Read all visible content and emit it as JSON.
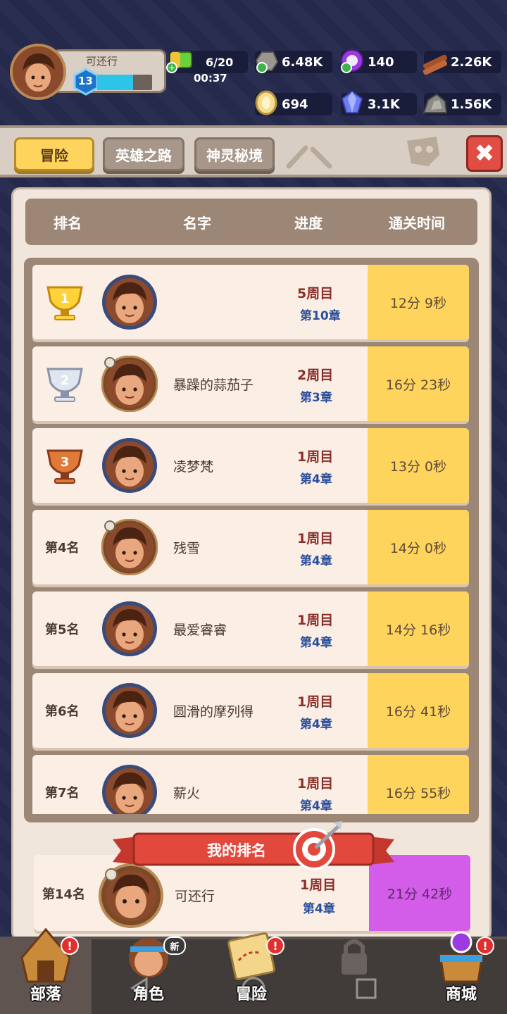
{
  "player": {
    "name": "可还行",
    "level": "13",
    "xp_fraction": 0.65
  },
  "resources": {
    "energy": {
      "value": "6/20",
      "timer": "00:37",
      "icon": "energy-battery-icon"
    },
    "stone": {
      "value": "6.48K",
      "icon": "stone-icon"
    },
    "orb": {
      "value": "140",
      "icon": "purple-orb-icon"
    },
    "wood": {
      "value": "2.26K",
      "icon": "wood-logs-icon"
    },
    "bone": {
      "value": "694",
      "icon": "bone-coin-icon"
    },
    "gem": {
      "value": "3.1K",
      "icon": "blue-gem-icon"
    },
    "ore": {
      "value": "1.56K",
      "icon": "ore-icon"
    }
  },
  "tabs": [
    {
      "label": "冒险",
      "active": true
    },
    {
      "label": "英雄之路",
      "active": false
    },
    {
      "label": "神灵秘境",
      "active": false
    }
  ],
  "close_label": "✖",
  "table": {
    "headers": {
      "rank": "排名",
      "name": "名字",
      "progress": "进度",
      "time": "通关时间"
    },
    "rows": [
      {
        "rank": "",
        "trophy": "gold",
        "trophy_num": "1",
        "name": "",
        "cycle": "5周目",
        "chapter": "第10章",
        "time": "12分 9秒",
        "framed_avatar": false
      },
      {
        "rank": "",
        "trophy": "silver",
        "trophy_num": "2",
        "name": "暴躁的蒜茄子",
        "cycle": "2周目",
        "chapter": "第3章",
        "time": "16分 23秒",
        "framed_avatar": true
      },
      {
        "rank": "",
        "trophy": "bronze",
        "trophy_num": "3",
        "name": "凌梦梵",
        "cycle": "1周目",
        "chapter": "第4章",
        "time": "13分 0秒",
        "framed_avatar": false
      },
      {
        "rank": "第4名",
        "trophy": "",
        "trophy_num": "",
        "name": "残雪",
        "cycle": "1周目",
        "chapter": "第4章",
        "time": "14分 0秒",
        "framed_avatar": true
      },
      {
        "rank": "第5名",
        "trophy": "",
        "trophy_num": "",
        "name": "最爱睿睿",
        "cycle": "1周目",
        "chapter": "第4章",
        "time": "14分 16秒",
        "framed_avatar": false
      },
      {
        "rank": "第6名",
        "trophy": "",
        "trophy_num": "",
        "name": "圆滑的摩列得",
        "cycle": "1周目",
        "chapter": "第4章",
        "time": "16分 41秒",
        "framed_avatar": false
      },
      {
        "rank": "第7名",
        "trophy": "",
        "trophy_num": "",
        "name": "薪火",
        "cycle": "1周目",
        "chapter": "第4章",
        "time": "16分 55秒",
        "framed_avatar": false
      }
    ]
  },
  "my_rank": {
    "title": "我的排名",
    "rank": "第14名",
    "name": "可还行",
    "cycle": "1周目",
    "chapter": "第4章",
    "time": "21分 42秒"
  },
  "nav": [
    {
      "label": "部落",
      "icon": "tribe-hut-icon",
      "badge": "!",
      "active": true
    },
    {
      "label": "角色",
      "icon": "character-icon",
      "badge": "新",
      "active": false
    },
    {
      "label": "冒险",
      "icon": "adventure-map-icon",
      "badge": "!",
      "active": false
    },
    {
      "label": "",
      "icon": "lock-icon",
      "badge": "",
      "active": false
    },
    {
      "label": "商城",
      "icon": "shop-icon",
      "badge": "!",
      "active": false
    }
  ],
  "colors": {
    "background": "#262a4e",
    "tab_active": "#ffd45c",
    "time_cell": "#ffd45c",
    "my_time_cell": "#d35ce8",
    "close": "#e14c43",
    "progress_cycle": "#8a2f2a",
    "progress_chapter": "#2a4f9a"
  }
}
